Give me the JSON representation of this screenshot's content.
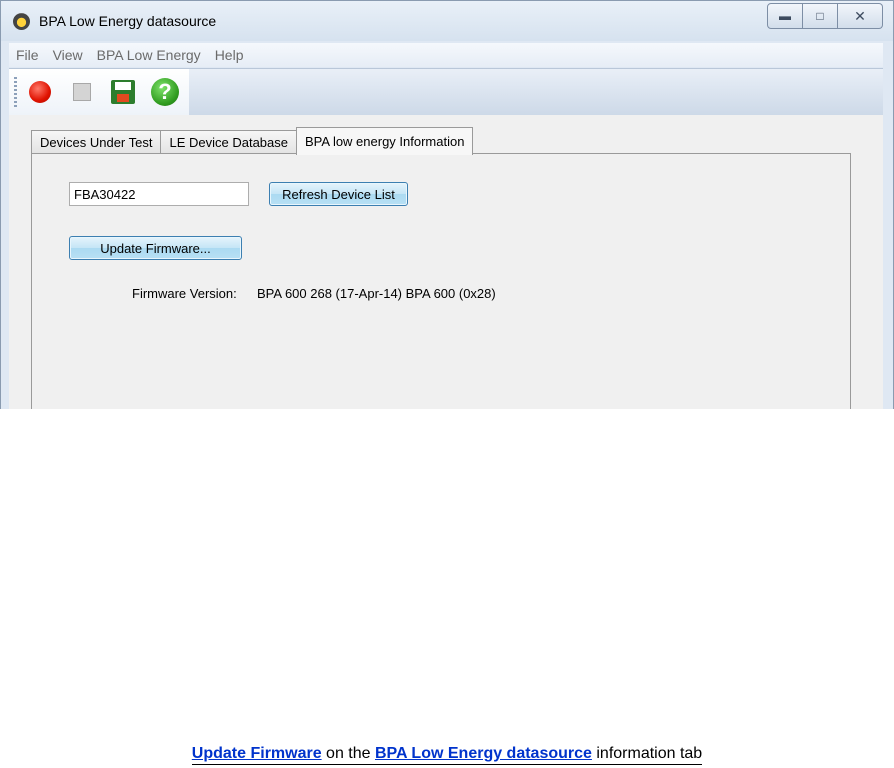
{
  "window": {
    "title": "BPA Low Energy datasource",
    "minimize_icon": "minimize-icon",
    "maximize_icon": "maximize-icon",
    "close_icon": "close-icon"
  },
  "menu": {
    "items": [
      "File",
      "View",
      "BPA Low Energy",
      "Help"
    ]
  },
  "toolbar": {
    "help_glyph": "?",
    "icons": [
      "record-icon",
      "stop-icon",
      "save-icon",
      "help-icon"
    ]
  },
  "tabs": [
    {
      "label": "Devices Under Test",
      "active": false
    },
    {
      "label": "LE Device Database",
      "active": false
    },
    {
      "label": "BPA low energy Information",
      "active": true
    }
  ],
  "panel": {
    "device_value": "FBA30422",
    "refresh_label": "Refresh Device List",
    "update_label": "Update Firmware...",
    "firmware_label": "Firmware Version:",
    "firmware_value": "BPA 600 268 (17-Apr-14) BPA 600 (0x28)"
  },
  "caption": {
    "part1": "Update Firmware",
    "part2": " on the ",
    "part3": "BPA Low Energy datasource",
    "part4": " information tab"
  },
  "colors": {
    "accent_link": "#0033cc",
    "record": "#e01200",
    "help": "#2f9b1f"
  }
}
